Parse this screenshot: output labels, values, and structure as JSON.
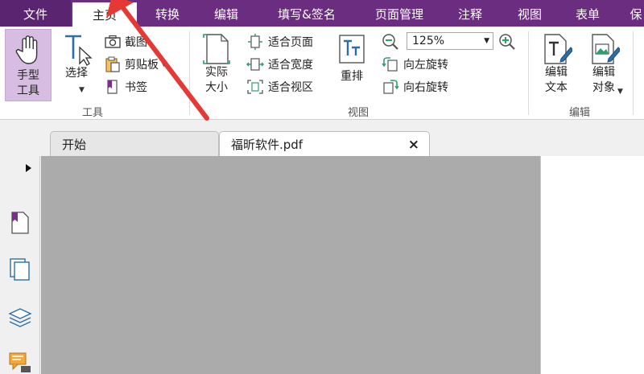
{
  "menu_tabs": [
    "文件",
    "主页",
    "转换",
    "编辑",
    "填写&签名",
    "页面管理",
    "注释",
    "视图",
    "表单",
    "保"
  ],
  "ribbon": {
    "tools_group": {
      "hand_tool_label": "手型工具",
      "hand_tool_line1": "手型",
      "hand_tool_line2": "工具",
      "select_label": "选择",
      "screenshot_label": "截图",
      "clipboard_label": "剪贴板",
      "bookmark_label": "书签",
      "group_label": "工具"
    },
    "view_group": {
      "actual_size_line1": "实际",
      "actual_size_line2": "大小",
      "fit_page_label": "适合页面",
      "fit_width_label": "适合宽度",
      "fit_view_label": "适合视区",
      "reflow_label": "重排",
      "zoom_value": "125%",
      "rotate_left_label": "向左旋转",
      "rotate_right_label": "向右旋转",
      "group_label": "视图"
    },
    "edit_group": {
      "edit_text_line1": "编辑",
      "edit_text_line2": "文本",
      "edit_object_line1": "编辑",
      "edit_object_line2": "对象",
      "group_label": "编辑"
    }
  },
  "doc_tabs": [
    {
      "label": "开始"
    },
    {
      "label": "福昕软件.pdf",
      "close": "×"
    }
  ],
  "colors": {
    "menubar": "#6b2d80",
    "accent": "#6b2d80",
    "hand_tool_bg": "#d8bde2",
    "doc_area": "#ababab",
    "annotation_arrow": "#e53935"
  },
  "icons": [
    "hand-icon",
    "select-cursor-icon",
    "camera-icon",
    "clipboard-icon",
    "bookmark-icon",
    "actual-size-icon",
    "fit-page-icon",
    "fit-width-icon",
    "fit-view-icon",
    "reflow-icon",
    "zoom-out-icon",
    "zoom-in-icon",
    "rotate-left-icon",
    "rotate-right-icon",
    "edit-text-icon",
    "edit-object-icon",
    "page-thumbnail-icon",
    "pages-icon",
    "layers-icon",
    "comments-icon"
  ]
}
